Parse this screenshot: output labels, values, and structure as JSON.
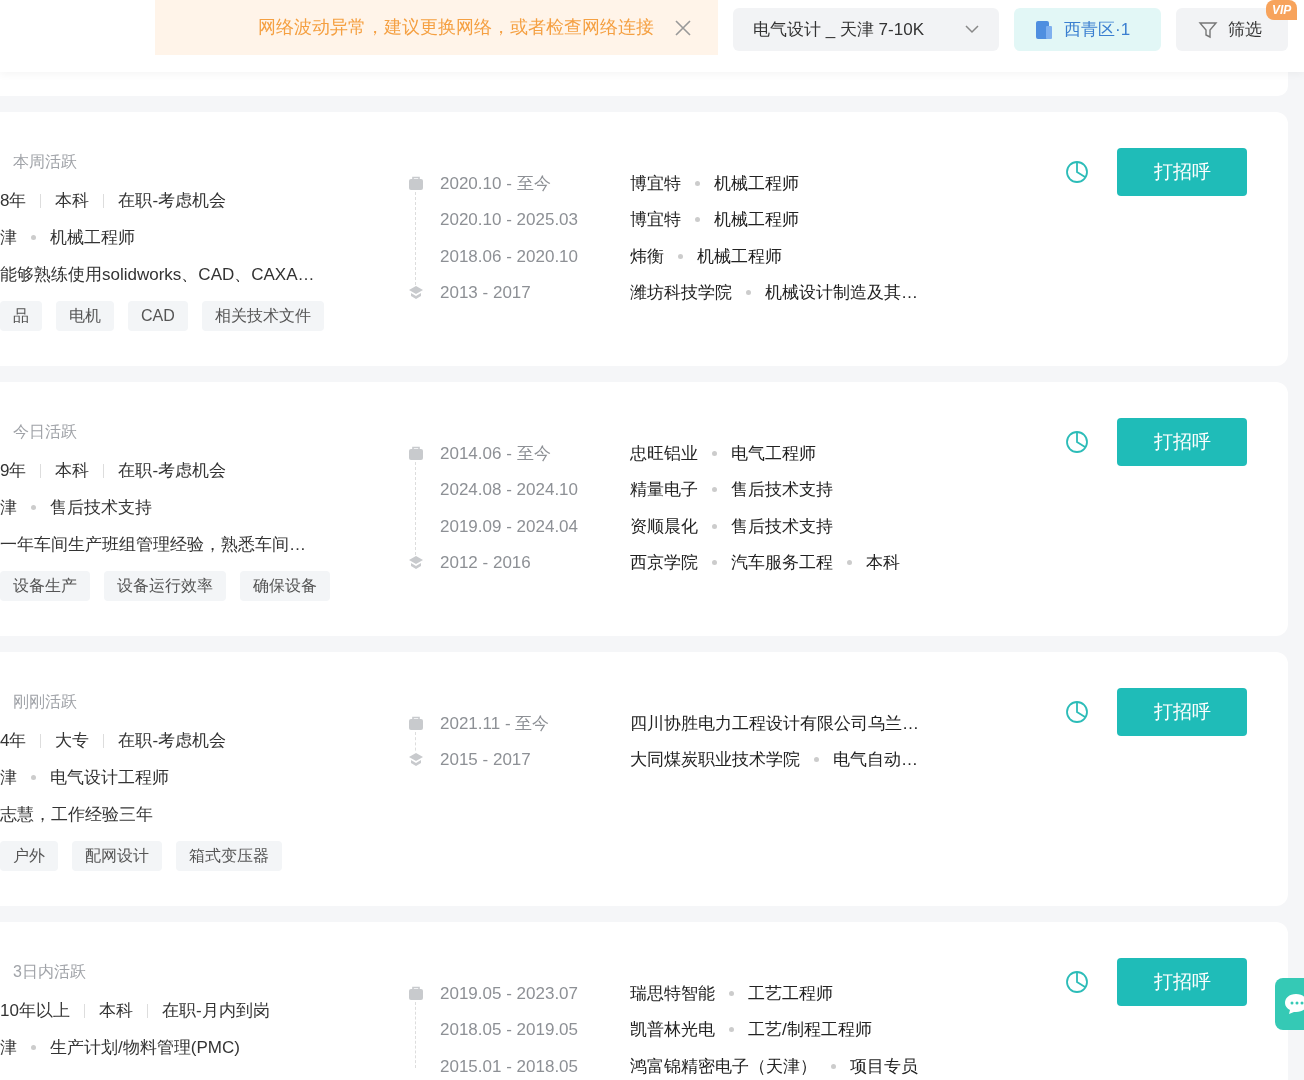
{
  "alert": {
    "text": "网络波动异常，建议更换网络，或者检查网络连接"
  },
  "job_select": {
    "value": "电气设计 _ 天津 7-10K"
  },
  "area_button": {
    "label": "西青区·1"
  },
  "filter_button": {
    "label": "筛选",
    "badge": "VIP"
  },
  "candidates": [
    {
      "activity": "本周活跃",
      "facts": [
        "8年",
        "本科",
        "在职-考虑机会"
      ],
      "city": "津",
      "position": "机械工程师",
      "description": "能够熟练使用solidworks、CAD、CAXA…",
      "tags": [
        "品",
        "电机",
        "CAD",
        "相关技术文件"
      ],
      "action": "打招呼",
      "timeline": [
        {
          "kind": "work",
          "dates": "2020.10 - 至今",
          "parts": [
            "博宜特",
            "机械工程师"
          ]
        },
        {
          "kind": "work",
          "dates": "2020.10 - 2025.03",
          "parts": [
            "博宜特",
            "机械工程师"
          ]
        },
        {
          "kind": "work",
          "dates": "2018.06 - 2020.10",
          "parts": [
            "炜衡",
            "机械工程师"
          ]
        },
        {
          "kind": "edu",
          "dates": "2013 - 2017",
          "parts": [
            "潍坊科技学院",
            "机械设计制造及其…"
          ]
        }
      ]
    },
    {
      "activity": "今日活跃",
      "facts": [
        "9年",
        "本科",
        "在职-考虑机会"
      ],
      "city": "津",
      "position": "售后技术支持",
      "description": "一年车间生产班组管理经验，熟悉车间…",
      "tags": [
        "设备生产",
        "设备运行效率",
        "确保设备"
      ],
      "action": "打招呼",
      "timeline": [
        {
          "kind": "work",
          "dates": "2014.06 - 至今",
          "parts": [
            "忠旺铝业",
            "电气工程师"
          ]
        },
        {
          "kind": "work",
          "dates": "2024.08 - 2024.10",
          "parts": [
            "精量电子",
            "售后技术支持"
          ]
        },
        {
          "kind": "work",
          "dates": "2019.09 - 2024.04",
          "parts": [
            "资顺晨化",
            "售后技术支持"
          ]
        },
        {
          "kind": "edu",
          "dates": "2012 - 2016",
          "parts": [
            "西京学院",
            "汽车服务工程",
            "本科"
          ]
        }
      ]
    },
    {
      "activity": "刚刚活跃",
      "facts": [
        "4年",
        "大专",
        "在职-考虑机会"
      ],
      "city": "津",
      "position": "电气设计工程师",
      "description": "志慧，工作经验三年",
      "tags": [
        "户外",
        "配网设计",
        "箱式变压器"
      ],
      "action": "打招呼",
      "timeline": [
        {
          "kind": "work",
          "dates": "2021.11 - 至今",
          "parts": [
            "四川协胜电力工程设计有限公司乌兰…"
          ]
        },
        {
          "kind": "edu",
          "dates": "2015 - 2017",
          "parts": [
            "大同煤炭职业技术学院",
            "电气自动…"
          ]
        }
      ]
    },
    {
      "activity": "3日内活跃",
      "facts": [
        "10年以上",
        "本科",
        "在职-月内到岗"
      ],
      "city": "津",
      "position": "生产计划/物料管理(PMC)",
      "action": "打招呼",
      "timeline": [
        {
          "kind": "work",
          "dates": "2019.05 - 2023.07",
          "parts": [
            "瑞思特智能",
            "工艺工程师"
          ]
        },
        {
          "kind": "work",
          "dates": "2018.05 - 2019.05",
          "parts": [
            "凯普林光电",
            "工艺/制程工程师"
          ]
        },
        {
          "kind": "work",
          "dates": "2015.01 - 2018.05",
          "parts": [
            "鸿富锦精密电子（天津）",
            "项目专员"
          ]
        }
      ]
    }
  ]
}
